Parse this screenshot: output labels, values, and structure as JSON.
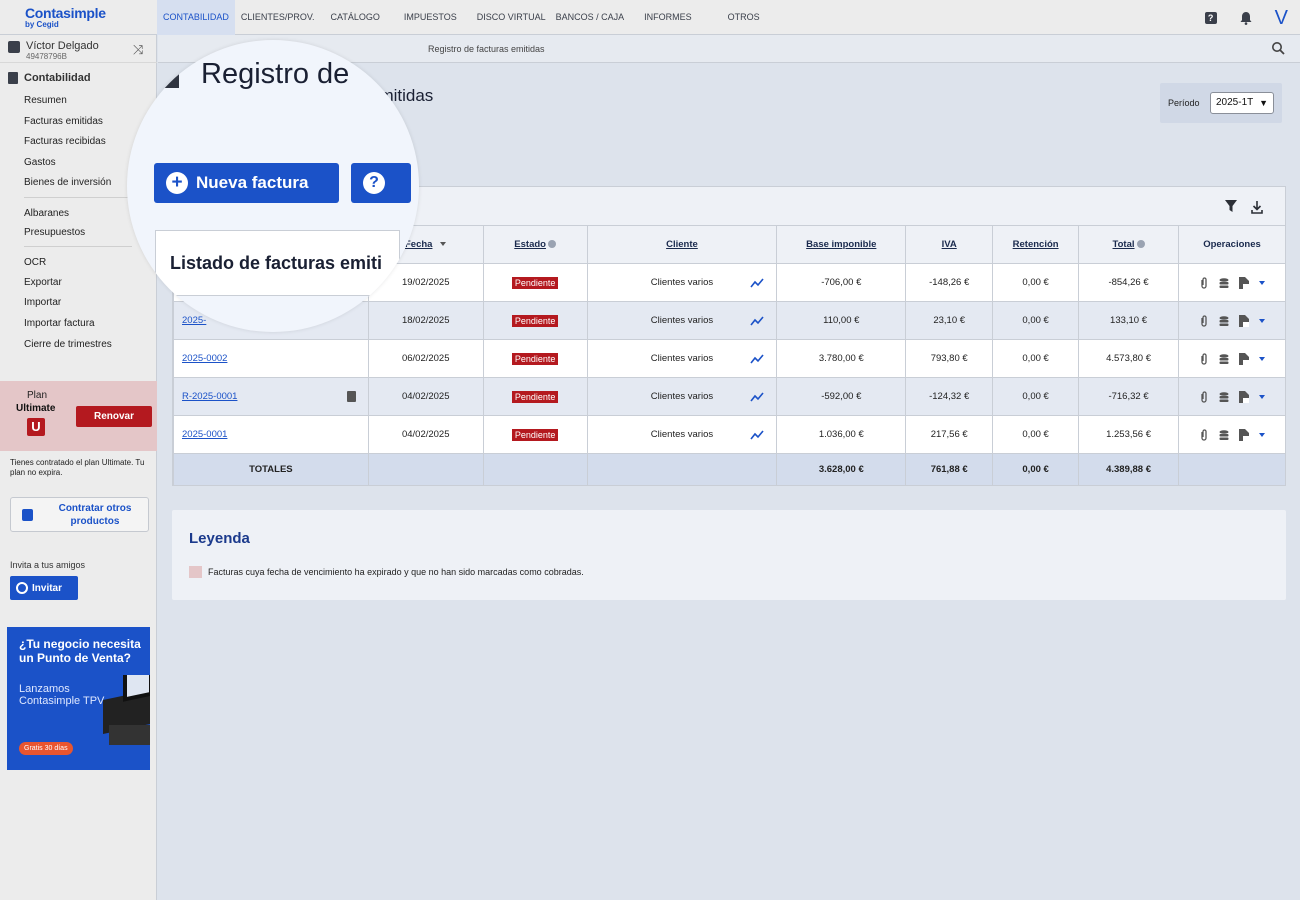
{
  "app": {
    "logo_main": "Contasimple",
    "logo_sub": "by Cegid"
  },
  "topnav": [
    {
      "label": "CONTABILIDAD",
      "active": true
    },
    {
      "label": "CLIENTES/PROV."
    },
    {
      "label": "CATÁLOGO"
    },
    {
      "label": "IMPUESTOS"
    },
    {
      "label": "DISCO VIRTUAL"
    },
    {
      "label": "BANCOS / CAJA"
    },
    {
      "label": "INFORMES"
    },
    {
      "label": "OTROS"
    }
  ],
  "top_icons": {
    "help": "?",
    "user_initial": "V"
  },
  "user": {
    "name": "Víctor Delgado",
    "id": "49478796B"
  },
  "sidebar": {
    "section": "Contabilidad",
    "items": [
      "Resumen",
      "Facturas emitidas",
      "Facturas recibidas",
      "Gastos",
      "Bienes de inversión",
      "Albaranes",
      "Presupuestos",
      "OCR",
      "Exportar",
      "Importar",
      "Importar factura",
      "Cierre de trimestres"
    ],
    "plan_label": "Plan",
    "plan_name": "Ultimate",
    "plan_badge": "U",
    "renew": "Renovar",
    "plan_note": "Tienes contratado el plan Ultimate. Tu plan no expira.",
    "other_products": "Contratar otros productos",
    "invite_label": "Invita a tus amigos",
    "invite_btn": "Invitar",
    "promo_title": "¿Tu negocio necesita un Punto de Venta?",
    "promo_sub": "Lanzamos Contasimple TPV",
    "promo_badge": "Gratis 30 días"
  },
  "breadcrumb": "Registro de facturas emitidas",
  "page": {
    "title_tail": "emitidas",
    "period_label": "Período",
    "period_value": "2025-1T"
  },
  "magnifier": {
    "title": "Registro de",
    "new_invoice": "Nueva factura",
    "help": "?",
    "list_title": "Listado de facturas emiti"
  },
  "table": {
    "headers": {
      "fecha": "Fecha",
      "estado": "Estado",
      "cliente": "Cliente",
      "base": "Base imponible",
      "iva": "IVA",
      "retencion": "Retención",
      "total": "Total",
      "operaciones": "Operaciones"
    },
    "rows": [
      {
        "num": "",
        "fecha": "19/02/2025",
        "estado": "Pendiente",
        "cliente": "Clientes varios",
        "base": "-706,00 €",
        "iva": "-148,26 €",
        "ret": "0,00 €",
        "total": "-854,26 €"
      },
      {
        "num": "2025-",
        "fecha": "18/02/2025",
        "estado": "Pendiente",
        "cliente": "Clientes varios",
        "base": "110,00 €",
        "iva": "23,10 €",
        "ret": "0,00 €",
        "total": "133,10 €"
      },
      {
        "num": "2025-0002",
        "fecha": "06/02/2025",
        "estado": "Pendiente",
        "cliente": "Clientes varios",
        "base": "3.780,00 €",
        "iva": "793,80 €",
        "ret": "0,00 €",
        "total": "4.573,80 €"
      },
      {
        "num": "R-2025-0001",
        "fecha": "04/02/2025",
        "estado": "Pendiente",
        "cliente": "Clientes varios",
        "base": "-592,00 €",
        "iva": "-124,32 €",
        "ret": "0,00 €",
        "total": "-716,32 €"
      },
      {
        "num": "2025-0001",
        "fecha": "04/02/2025",
        "estado": "Pendiente",
        "cliente": "Clientes varios",
        "base": "1.036,00 €",
        "iva": "217,56 €",
        "ret": "0,00 €",
        "total": "1.253,56 €"
      }
    ],
    "totals": {
      "label": "TOTALES",
      "base": "3.628,00 €",
      "iva": "761,88 €",
      "ret": "0,00 €",
      "total": "4.389,88 €"
    }
  },
  "legend": {
    "title": "Leyenda",
    "text": "Facturas cuya fecha de vencimiento ha expirado y que no han sido marcadas como cobradas."
  },
  "colors": {
    "brand": "#1b52c8",
    "danger": "#b4191f",
    "overdue": "#e4c6c8"
  }
}
